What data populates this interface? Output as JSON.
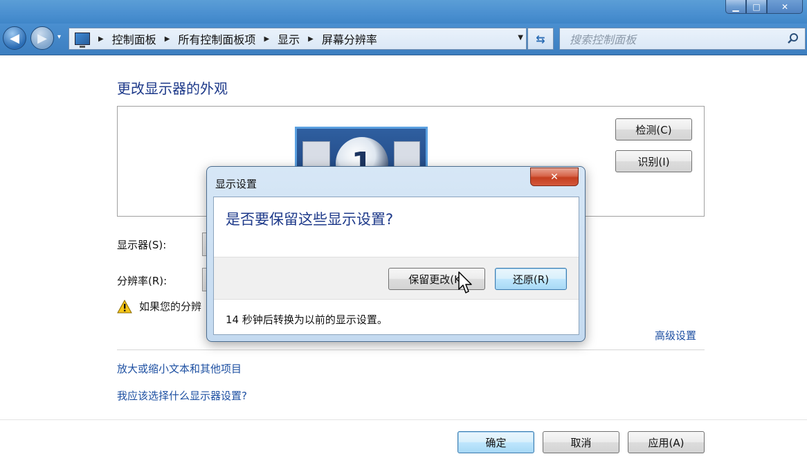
{
  "window": {
    "minimize": "▁",
    "maximize": "□",
    "close": "✕"
  },
  "nav": {
    "back": "◀",
    "forward": "▶",
    "history": "▾"
  },
  "address": {
    "crumbs": [
      "控制面板",
      "所有控制面板项",
      "显示",
      "屏幕分辨率"
    ],
    "dropdown": "▼",
    "refresh": "⇆"
  },
  "search": {
    "placeholder": "搜索控制面板"
  },
  "page": {
    "title": "更改显示器的外观",
    "monitor_number": "1",
    "detect_button": "检测(C)",
    "identify_button": "识别(I)",
    "display_label": "显示器(S):",
    "resolution_label": "分辨率(R):",
    "warning_text": "如果您的分辨",
    "advanced_link": "高级设置",
    "text_size_link": "放大或缩小文本和其他项目",
    "which_settings_link": "我应该选择什么显示器设置?",
    "ok_button": "确定",
    "cancel_button": "取消",
    "apply_button": "应用(A)"
  },
  "dialog": {
    "title": "显示设置",
    "close": "✕",
    "question": "是否要保留这些显示设置?",
    "keep_button": "保留更改(K)",
    "revert_button": "还原(R)",
    "countdown": "14 秒钟后转换为以前的显示设置。"
  }
}
